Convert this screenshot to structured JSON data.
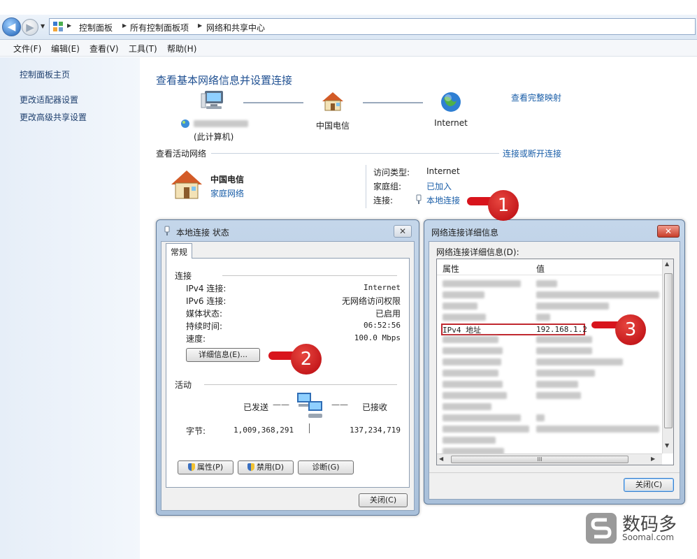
{
  "address_bar": {
    "crumbs": [
      "控制面板",
      "所有控制面板项",
      "网络和共享中心"
    ]
  },
  "menu": [
    "文件(F)",
    "编辑(E)",
    "查看(V)",
    "工具(T)",
    "帮助(H)"
  ],
  "sidebar": {
    "items": [
      "控制面板主页",
      "更改适配器设置",
      "更改高级共享设置"
    ]
  },
  "main": {
    "title": "查看基本网络信息并设置连接",
    "full_map_link": "查看完整映射",
    "map": {
      "computer_label": "(此计算机)",
      "isp_label": "中国电信",
      "internet_label": "Internet"
    },
    "active_header": "查看活动网络",
    "connect_link": "连接或断开连接",
    "network_name": "中国电信",
    "network_type": "家庭网络",
    "access_type_label": "访问类型:",
    "access_type_value": "Internet",
    "homegroup_label": "家庭组:",
    "homegroup_value": "已加入",
    "connection_label": "连接:",
    "connection_value": "本地连接"
  },
  "status_dialog": {
    "title": "本地连接 状态",
    "tab": "常规",
    "connection_group": "连接",
    "rows": [
      {
        "label": "IPv4 连接:",
        "value": "Internet"
      },
      {
        "label": "IPv6 连接:",
        "value": "无网络访问权限"
      },
      {
        "label": "媒体状态:",
        "value": "已启用"
      },
      {
        "label": "持续时间:",
        "value": "06:52:56"
      },
      {
        "label": "速度:",
        "value": "100.0 Mbps"
      }
    ],
    "details_button": "详细信息(E)...",
    "activity_group": "活动",
    "sent_label": "已发送",
    "received_label": "已接收",
    "bytes_label": "字节:",
    "bytes_sent": "1,009,368,291",
    "bytes_received": "137,234,719",
    "properties_button": "属性(P)",
    "disable_button": "禁用(D)",
    "diagnose_button": "诊断(G)",
    "close_button": "关闭(C)",
    "close_x": "✕"
  },
  "details_dialog": {
    "title": "网络连接详细信息",
    "list_caption": "网络连接详细信息(D):",
    "col_property": "属性",
    "col_value": "值",
    "highlight_property": "IPv4 地址",
    "highlight_value": "192.168.1.2",
    "scroll_mark": "III",
    "close_button": "关闭(C)",
    "close_x": "✕"
  },
  "callouts": [
    "1",
    "2",
    "3"
  ],
  "watermark": {
    "name": "数码多",
    "site": "Soomal.com"
  },
  "colors": {
    "link": "#1a5ea8",
    "callout_red": "#d8141c",
    "highlight_box": "#c0282f"
  }
}
